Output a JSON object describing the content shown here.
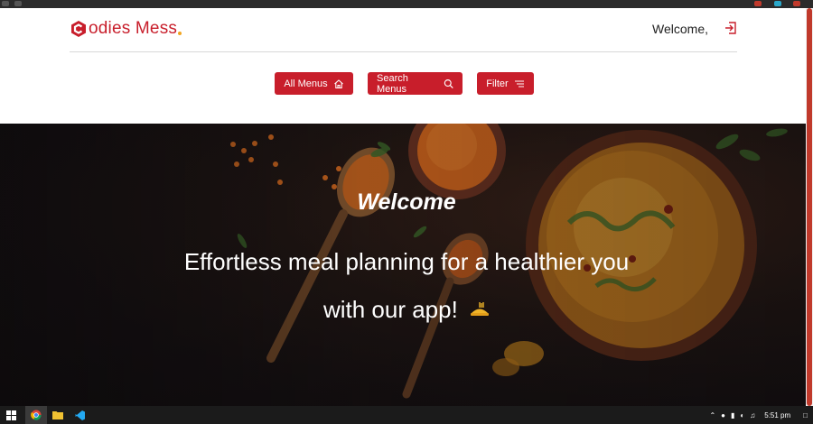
{
  "header": {
    "brand": {
      "initial": "C",
      "name": "odies Mess",
      "accent_color": "#c81e2b",
      "dot_color": "#f1a520"
    },
    "welcome_text": "Welcome,",
    "logout_icon": "logout-icon"
  },
  "nav": {
    "buttons": [
      {
        "label": "All Menus",
        "icon": "home-icon"
      },
      {
        "label": "Search Menus",
        "icon": "search-icon"
      },
      {
        "label": "Filter",
        "icon": "filter-icon"
      }
    ],
    "button_color": "#c81e2b"
  },
  "hero": {
    "title": "Welcome",
    "line1": "Effortless meal planning for a healthier you",
    "line2": "with our app!",
    "emoji_icon": "food-icon"
  },
  "taskbar": {
    "apps": [
      "windows-start-icon",
      "chrome-icon",
      "file-explorer-icon",
      "vscode-icon"
    ],
    "time": "5:51 pm"
  }
}
